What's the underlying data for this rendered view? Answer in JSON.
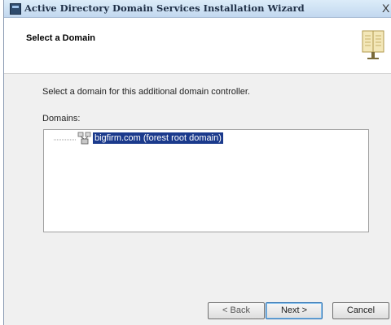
{
  "window": {
    "title": "Active Directory Domain Services Installation Wizard",
    "close_glyph": "X"
  },
  "header": {
    "title": "Select a Domain",
    "icon": "book-icon"
  },
  "content": {
    "instruction": "Select a domain for this additional domain controller.",
    "domains_label": "Domains:",
    "tree": [
      {
        "label": "bigfirm.com (forest root domain)",
        "selected": true,
        "icon": "domain-icon"
      }
    ]
  },
  "footer": {
    "back_label": "< Back",
    "next_label": "Next >",
    "cancel_label": "Cancel"
  },
  "colors": {
    "selection": "#1b3a8c",
    "titlebar": "#c2d8ef",
    "dialog_bg": "#f0f0f0"
  }
}
